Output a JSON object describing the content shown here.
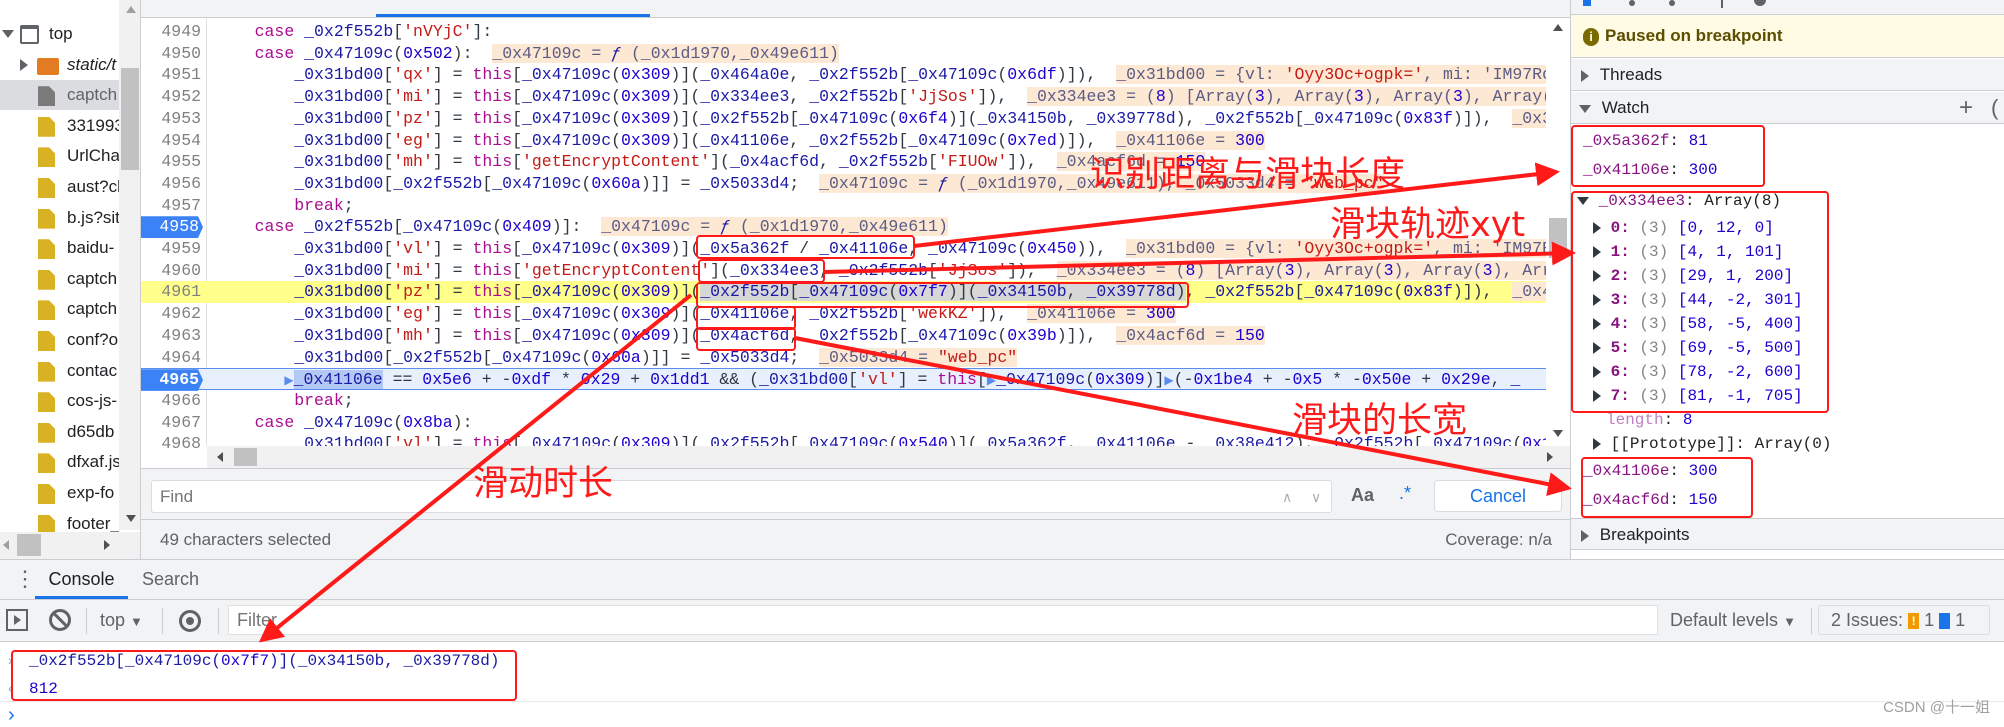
{
  "sidebar": {
    "items": [
      {
        "label": "top",
        "icon": "window-icon",
        "indent": 0,
        "expanded": true
      },
      {
        "label": "static/t",
        "icon": "folder-icon",
        "indent": 1,
        "expanded": false,
        "italic": true
      },
      {
        "label": "captch",
        "icon": "file-gray-icon",
        "indent": 1,
        "selected": true
      },
      {
        "label": "331993",
        "icon": "file-yellow-icon",
        "indent": 1
      },
      {
        "label": "UrlCha",
        "icon": "file-yellow-icon",
        "indent": 1
      },
      {
        "label": "aust?cl",
        "icon": "file-yellow-icon",
        "indent": 1
      },
      {
        "label": "b.js?sit",
        "icon": "file-yellow-icon",
        "indent": 1
      },
      {
        "label": "baidu-",
        "icon": "file-yellow-icon",
        "indent": 1
      },
      {
        "label": "captch",
        "icon": "file-yellow-icon",
        "indent": 1
      },
      {
        "label": "captch",
        "icon": "file-yellow-icon",
        "indent": 1
      },
      {
        "label": "conf?o",
        "icon": "file-yellow-icon",
        "indent": 1
      },
      {
        "label": "contac",
        "icon": "file-yellow-icon",
        "indent": 1
      },
      {
        "label": "cos-js-",
        "icon": "file-yellow-icon",
        "indent": 1
      },
      {
        "label": "d65db",
        "icon": "file-yellow-icon",
        "indent": 1
      },
      {
        "label": "dfxaf.js",
        "icon": "file-yellow-icon",
        "indent": 1
      },
      {
        "label": "exp-fo",
        "icon": "file-yellow-icon",
        "indent": 1
      },
      {
        "label": "footer_",
        "icon": "file-yellow-icon",
        "indent": 1
      }
    ]
  },
  "editor": {
    "lines": [
      {
        "n": "4949",
        "parts": [
          {
            "k": "code",
            "t": "    case _0x2f552b['nVYjC']:"
          }
        ]
      },
      {
        "n": "4950",
        "parts": [
          {
            "k": "code",
            "t": "    case _0x47109c(0x502):  "
          },
          {
            "k": "ann",
            "t": "_0x47109c = ƒ (_0x1d1970,_0x49e611)"
          }
        ]
      },
      {
        "n": "4951",
        "parts": [
          {
            "k": "code",
            "t": "        _0x31bd00['qx'] = this[_0x47109c(0x309)](_0x464a0e, _0x2f552b[_0x47109c(0x6df)]),  "
          },
          {
            "k": "ann",
            "t": "_0x31bd00 = {vl: 'Oyy3Oc+ogpk=', mi: 'IM97RorY"
          }
        ]
      },
      {
        "n": "4952",
        "parts": [
          {
            "k": "code",
            "t": "        _0x31bd00['mi'] = this[_0x47109c(0x309)](_0x334ee3, _0x2f552b['JjSos']),  "
          },
          {
            "k": "ann",
            "t": "_0x334ee3 = (8) [Array(3), Array(3), Array(3), Array(3)"
          }
        ]
      },
      {
        "n": "4953",
        "parts": [
          {
            "k": "code",
            "t": "        _0x31bd00['pz'] = this[_0x47109c(0x309)](_0x2f552b[_0x47109c(0x6f4)](_0x34150b, _0x39778d), _0x2f552b[_0x47109c(0x83f)]),  "
          },
          {
            "k": "ann",
            "t": "_0x341"
          }
        ]
      },
      {
        "n": "4954",
        "parts": [
          {
            "k": "code",
            "t": "        _0x31bd00['eg'] = this[_0x47109c(0x309)](_0x41106e, _0x2f552b[_0x47109c(0x7ed)]),  "
          },
          {
            "k": "ann",
            "t": "_0x41106e = 300"
          }
        ]
      },
      {
        "n": "4955",
        "parts": [
          {
            "k": "code",
            "t": "        _0x31bd00['mh'] = this['getEncryptContent'](_0x4acf6d, _0x2f552b['FIUOw']),  "
          },
          {
            "k": "ann",
            "t": "_0x4acf6d = 150"
          }
        ]
      },
      {
        "n": "4956",
        "parts": [
          {
            "k": "code",
            "t": "        _0x31bd00[_0x2f552b[_0x47109c(0x60a)]] = _0x5033d4;  "
          },
          {
            "k": "ann",
            "t": "_0x47109c = ƒ (_0x1d1970,_0x49e611), _0x5033d4 = \"web_pc\""
          }
        ]
      },
      {
        "n": "4957",
        "parts": [
          {
            "k": "code",
            "t": "        break;"
          }
        ]
      },
      {
        "n": "4958",
        "bp": true,
        "parts": [
          {
            "k": "code",
            "t": "    case _0x2f552b[_0x47109c(0x409)]:  "
          },
          {
            "k": "ann",
            "t": "_0x47109c = ƒ (_0x1d1970,_0x49e611)"
          }
        ]
      },
      {
        "n": "4959",
        "parts": [
          {
            "k": "code",
            "t": "        _0x31bd00['vl'] = this[_0x47109c(0x309)](_0x5a362f / _0x41106e, _0x47109c(0x450)),  "
          },
          {
            "k": "ann",
            "t": "_0x31bd00 = {vl: 'Oyy3Oc+ogpk=', mi: 'IM97RorY"
          }
        ]
      },
      {
        "n": "4960",
        "parts": [
          {
            "k": "code",
            "t": "        _0x31bd00['mi'] = this['getEncryptContent'](_0x334ee3, _0x2f552b['JjSos']),  "
          },
          {
            "k": "ann",
            "t": "_0x334ee3 = (8) [Array(3), Array(3), Array(3), Array(3)"
          }
        ]
      },
      {
        "n": "4961",
        "hl": true,
        "parts": [
          {
            "k": "code",
            "t": "        _0x31bd00['pz'] = this[_0x47109c(0x309)]("
          },
          {
            "k": "sel",
            "t": "_0x2f552b[_0x47109c(0x7f7)](_0x34150b, _0x39778d)"
          },
          {
            "k": "code",
            "t": ", _0x2f552b[_0x47109c(0x83f)]),  "
          },
          {
            "k": "ann",
            "t": "_0x471"
          }
        ]
      },
      {
        "n": "4962",
        "parts": [
          {
            "k": "code",
            "t": "        _0x31bd00['eg'] = this[_0x47109c(0x309)](_0x41106e, _0x2f552b['wekKZ']),  "
          },
          {
            "k": "ann",
            "t": "_0x41106e = 300"
          }
        ]
      },
      {
        "n": "4963",
        "parts": [
          {
            "k": "code",
            "t": "        _0x31bd00['mh'] = this[_0x47109c(0x309)](_0x4acf6d, _0x2f552b[_0x47109c(0x39b)]),  "
          },
          {
            "k": "ann",
            "t": "_0x4acf6d = 150"
          }
        ]
      },
      {
        "n": "4964",
        "parts": [
          {
            "k": "code",
            "t": "        _0x31bd00[_0x2f552b[_0x47109c(0x60a)]] = _0x5033d4;  "
          },
          {
            "k": "ann",
            "t": "_0x5033d4 = \"web_pc\""
          }
        ]
      },
      {
        "n": "4965",
        "cur": true,
        "parts": [
          {
            "k": "code",
            "t": "       ▶"
          },
          {
            "k": "word",
            "t": "_0x41106e"
          },
          {
            "k": "code",
            "t": " == 0x5e6 + -0xdf * 0x29 + 0x1dd1 && (_0x31bd00['vl'] = this[▶_0x47109c(0x309)]▶(-0x1be4 + -0x5 * -0x50e + 0x29e, _"
          }
        ]
      },
      {
        "n": "4966",
        "parts": [
          {
            "k": "code",
            "t": "        break;"
          }
        ]
      },
      {
        "n": "4967",
        "parts": [
          {
            "k": "code",
            "t": "    case _0x47109c(0x8ba):"
          }
        ]
      },
      {
        "n": "4968",
        "parts": [
          {
            "k": "code",
            "t": "        _0x31bd00['vl'] = this[_0x47109c(0x309)](_0x2f552b[_0x47109c(0x540)](_0x5a362f, _0x41106e - _0x38e412), _0x2f552b[_0x47109c(0x1"
          }
        ]
      }
    ],
    "find": {
      "placeholder": "Find",
      "case_label": "Aa",
      "regex_label": ".*",
      "cancel_label": "Cancel"
    },
    "status": {
      "selection": "49 characters selected",
      "coverage": "Coverage: n/a"
    }
  },
  "debugger": {
    "paused_text": "Paused on breakpoint",
    "threads_label": "Threads",
    "watch_label": "Watch",
    "breakpoints_label": "Breakpoints",
    "watch": {
      "var1": {
        "name": "_0x5a362f",
        "value": "81"
      },
      "var2": {
        "name": "_0x41106e",
        "value": "300"
      },
      "array": {
        "name": "_0x334ee3",
        "type": "Array(8)",
        "items": [
          {
            "key": "0",
            "count": "(3)",
            "value": "[0, 12, 0]"
          },
          {
            "key": "1",
            "count": "(3)",
            "value": "[4, 1, 101]"
          },
          {
            "key": "2",
            "count": "(3)",
            "value": "[29, 1, 200]"
          },
          {
            "key": "3",
            "count": "(3)",
            "value": "[44, -2, 301]"
          },
          {
            "key": "4",
            "count": "(3)",
            "value": "[58, -5, 400]"
          },
          {
            "key": "5",
            "count": "(3)",
            "value": "[69, -5, 500]"
          },
          {
            "key": "6",
            "count": "(3)",
            "value": "[78, -2, 600]"
          },
          {
            "key": "7",
            "count": "(3)",
            "value": "[81, -1, 705]"
          }
        ],
        "length_label": "length",
        "length_value": "8",
        "prototype": "[[Prototype]]: Array(0)"
      },
      "var3": {
        "name": "_0x41106e",
        "value": "300"
      },
      "var4": {
        "name": "_0x4acf6d",
        "value": "150"
      }
    }
  },
  "console": {
    "tabs": [
      {
        "label": "Console",
        "active": true
      },
      {
        "label": "Search",
        "active": false
      }
    ],
    "context": "top",
    "filter_placeholder": "Filter",
    "levels": "Default levels",
    "issues_label": "2 Issues:",
    "issues_warn": "1",
    "issues_info": "1",
    "input_pre": "_0x2f552b[_0x47109c(",
    "input_num": "0x7f7",
    "input_post": ")](_0x34150b, _0x39778d)",
    "result": "812"
  },
  "annotations": {
    "label_distance": "识别距离与滑块长度",
    "label_track": "滑块轨迹xyt",
    "label_size": "滑块的长宽",
    "label_duration": "滑动时长",
    "color": "#ff1a1a"
  },
  "watermark": "CSDN @十一姐",
  "colors": {
    "accent": "#1a73e8",
    "current_line": "#e8f0fe",
    "highlight_line": "#ffff8a",
    "inline_value_bg": "#fde8d4",
    "paused_bg": "#fffbe5"
  }
}
